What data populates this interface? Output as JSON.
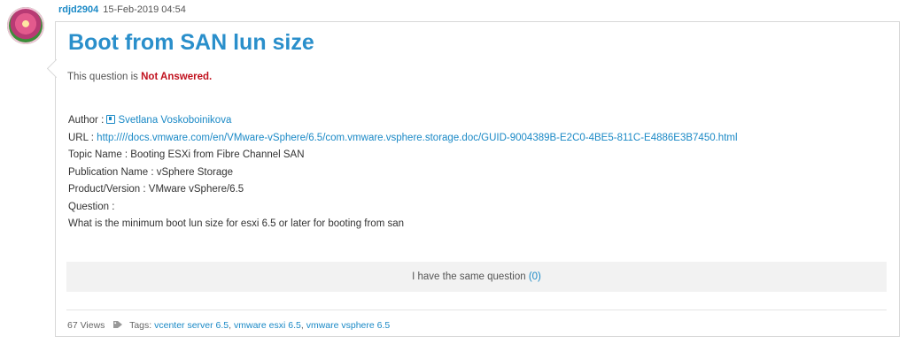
{
  "post": {
    "username": "rdjd2904",
    "date": "15-Feb-2019 04:54",
    "title": "Boot from SAN lun size",
    "status_prefix": "This question is ",
    "status_value": "Not Answered."
  },
  "details": {
    "author_label": "Author : ",
    "author_name": "Svetlana Voskoboinikova",
    "url_label": "URL : ",
    "url_value": "http:////docs.vmware.com/en/VMware-vSphere/6.5/com.vmware.vsphere.storage.doc/GUID-9004389B-E2C0-4BE5-811C-E4886E3B7450.html",
    "topic": "Topic Name : Booting ESXi from Fibre Channel SAN",
    "publication": "Publication Name : vSphere Storage",
    "product": "Product/Version : VMware vSphere/6.5",
    "question_label": "Question :",
    "question_text": "What is the minimum boot lun size for esxi 6.5 or later for booting from san"
  },
  "same_question": {
    "label": "I have the same question ",
    "count": "(0)"
  },
  "footer": {
    "views": "67 Views",
    "tags_label": "Tags:",
    "tags": [
      "vcenter server 6.5",
      "vmware esxi 6.5",
      "vmware vsphere 6.5"
    ]
  },
  "colors": {
    "accent": "#1a89c6",
    "title": "#2a8fcb",
    "not_answered": "#c1121f"
  },
  "icons": [
    "author-icon",
    "tag-icon"
  ]
}
